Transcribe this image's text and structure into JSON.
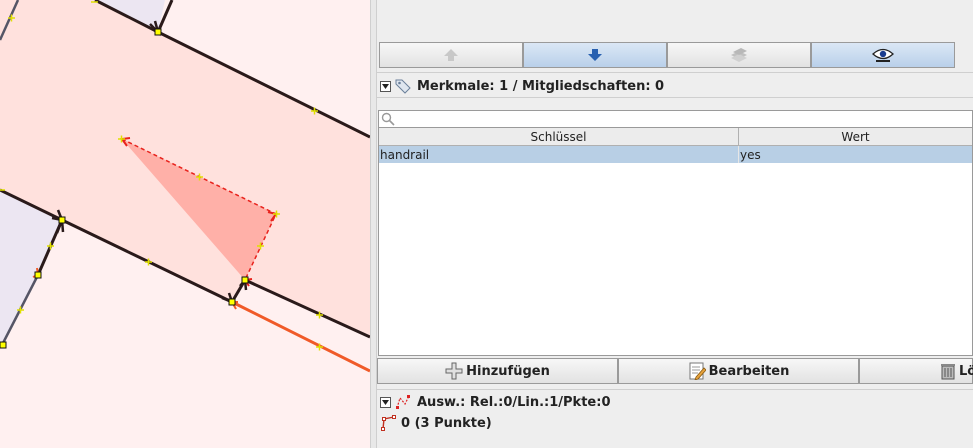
{
  "colors": {
    "map_bg": "#fff0f0",
    "building_fill": "#ffe1dd",
    "area_fill": "#ffb0a8",
    "way": "#2a1a1a",
    "selected_way": "#e8221c",
    "footway": "#f05a28",
    "row_selected": "#b8cfe5"
  },
  "map": {
    "description_icons": [
      "way-arrows",
      "node-markers"
    ]
  },
  "toolbar": {
    "buttons": [
      {
        "icon": "move-up-icon",
        "active": false
      },
      {
        "icon": "move-down-icon",
        "active": true
      },
      {
        "icon": "layers-icon",
        "active": false
      },
      {
        "icon": "eye-icon",
        "active": true
      }
    ]
  },
  "tags_panel": {
    "title": "Merkmale: 1 / Mitgliedschaften: 0",
    "search_placeholder": "",
    "columns": {
      "key": "Schlüssel",
      "value": "Wert"
    },
    "rows": [
      {
        "key": "handrail",
        "value": "yes"
      }
    ],
    "buttons": {
      "add": "Hinzufügen",
      "edit": "Bearbeiten",
      "delete": "Lö"
    }
  },
  "selection_panel": {
    "title": "Ausw.: Rel.:0/Lin.:1/Pkte:0",
    "items": [
      {
        "label": "0 (3 Punkte)",
        "icon": "way-icon"
      }
    ]
  }
}
